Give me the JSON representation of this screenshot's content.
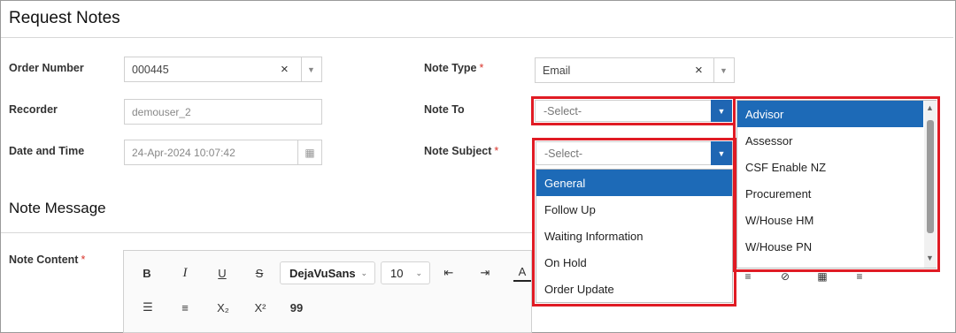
{
  "page": {
    "title": "Request Notes",
    "section_title": "Note Message"
  },
  "fields": {
    "order_number": {
      "label": "Order Number",
      "value": "000445",
      "clear": "×"
    },
    "recorder": {
      "label": "Recorder",
      "value": "demouser_2"
    },
    "date_time": {
      "label": "Date and Time",
      "value": "24-Apr-2024 10:07:42"
    },
    "note_type": {
      "label": "Note Type",
      "required": "*",
      "value": "Email",
      "clear": "×"
    },
    "note_to": {
      "label": "Note To",
      "placeholder": "-Select-"
    },
    "note_subject": {
      "label": "Note Subject",
      "required": "*",
      "placeholder": "-Select-"
    },
    "note_content": {
      "label": "Note Content",
      "required": "*"
    }
  },
  "note_subject_options": [
    "General",
    "Follow Up",
    "Waiting Information",
    "On Hold",
    "Order Update"
  ],
  "note_to_options": [
    "Advisor",
    "Assessor",
    "CSF Enable NZ",
    "Procurement",
    "W/House HM",
    "W/House PN"
  ],
  "toolbar": {
    "bold": "B",
    "italic": "I",
    "underline": "U",
    "strike": "S",
    "font_family": "DejaVuSans",
    "font_size": "10",
    "subscript": "X₂",
    "superscript": "X²",
    "quote": "99",
    "font_color": "A"
  },
  "colors": {
    "highlight": "#e01b24",
    "selected": "#1d6ab7"
  }
}
